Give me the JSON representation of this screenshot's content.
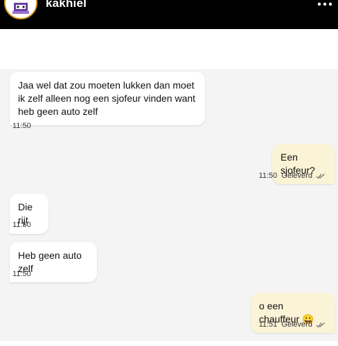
{
  "header": {
    "contact_name": "kakhiel",
    "avatar_icon": "avatar-icon",
    "more_icon": "more-icon"
  },
  "messages": [
    {
      "direction": "incoming",
      "text": "Jaa wel dat zou moeten lukken dan moet ik zelf alleen nog een sjofeur vinden want heb geen auto zelf",
      "time": "11:50"
    },
    {
      "direction": "outgoing",
      "text": "Een sjofeur?",
      "time": "11:50",
      "status": "Geleverd"
    },
    {
      "direction": "incoming",
      "text": "Die rijt",
      "time": "11:50"
    },
    {
      "direction": "incoming",
      "text": "Heb geen auto zelf",
      "time": "11:50"
    },
    {
      "direction": "outgoing",
      "text": "o een chauffeur 😀",
      "time": "11:51",
      "status": "Geleverd"
    }
  ],
  "colors": {
    "header_bg": "#000000",
    "chat_bg": "#f4f4f4",
    "incoming_bubble": "#ffffff",
    "outgoing_bubble": "#fbf3d6",
    "avatar_ring": "#e0a020"
  }
}
